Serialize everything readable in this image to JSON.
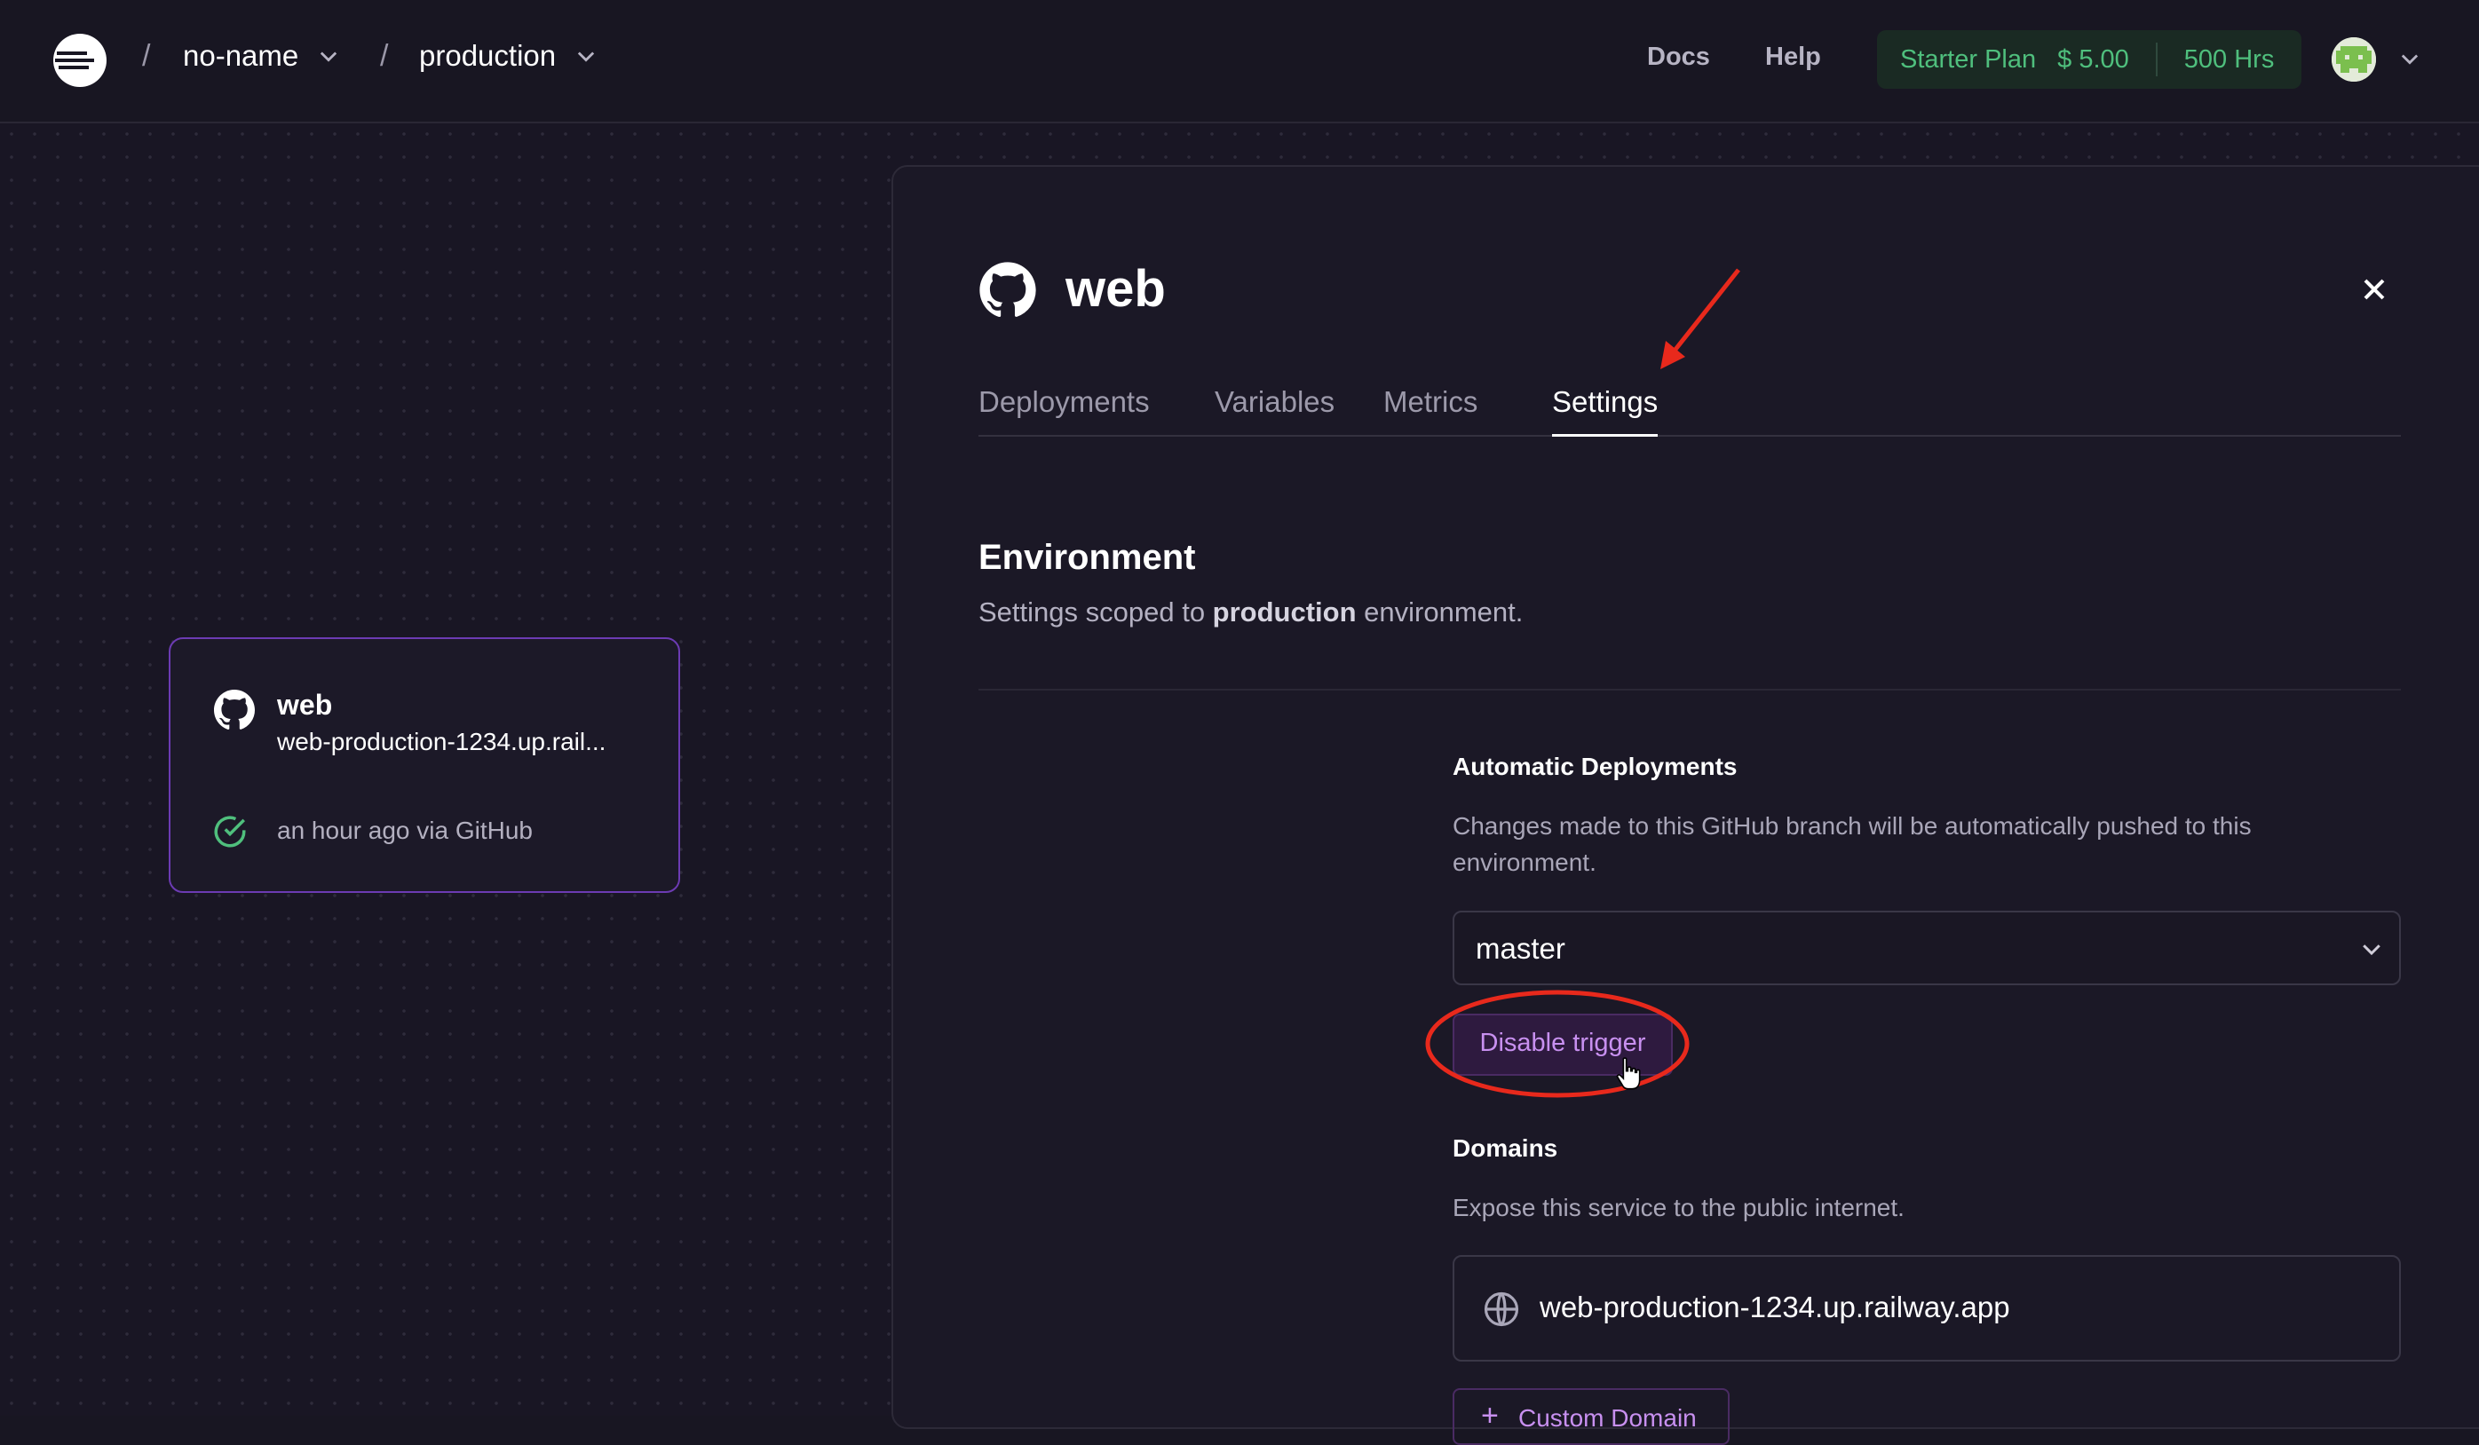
{
  "breadcrumb": {
    "separator": "/",
    "project": "no-name",
    "environment": "production"
  },
  "header": {
    "docs": "Docs",
    "help": "Help",
    "plan": {
      "name": "Starter Plan",
      "amount": "$ 5.00",
      "hours": "500 Hrs"
    }
  },
  "node": {
    "title": "web",
    "url": "web-production-1234.up.rail...",
    "status": "an hour ago via GitHub"
  },
  "panel": {
    "title": "web",
    "close_icon": "×",
    "tabs": [
      {
        "label": "Deployments",
        "active": false
      },
      {
        "label": "Variables",
        "active": false
      },
      {
        "label": "Metrics",
        "active": false
      },
      {
        "label": "Settings",
        "active": true
      }
    ],
    "environment": {
      "heading": "Environment",
      "sub_prefix": "Settings scoped to ",
      "sub_bold": "production",
      "sub_suffix": " environment."
    },
    "auto_deploy": {
      "heading": "Automatic Deployments",
      "description": "Changes made to this GitHub branch will be automatically pushed to this environment.",
      "branch": "master",
      "disable_button": "Disable trigger"
    },
    "domains": {
      "heading": "Domains",
      "description": "Expose this service to the public internet.",
      "domain": "web-production-1234.up.railway.app",
      "add_button": "Custom Domain"
    }
  },
  "colors": {
    "accent_purple": "#6c3bb3",
    "plan_green": "#4fbf7d",
    "annotation_red": "#e8291c"
  }
}
